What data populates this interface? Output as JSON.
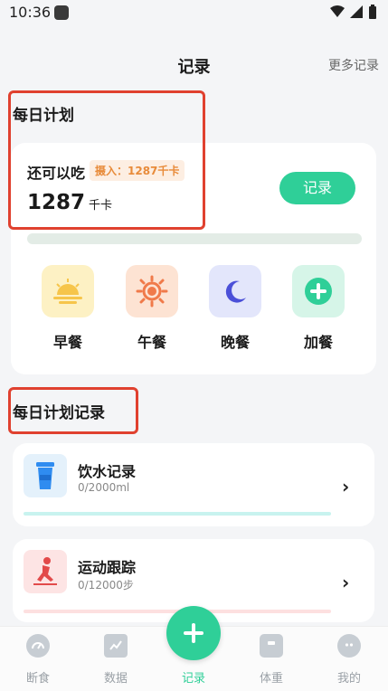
{
  "status_bar": {
    "time": "10:36"
  },
  "header": {
    "title": "记录",
    "more": "更多记录"
  },
  "daily_plan": {
    "section_title": "每日计划",
    "remain_label": "还可以吃",
    "intake_badge": "摄入：1287千卡",
    "kcal_value": "1287",
    "kcal_unit": "千卡",
    "record_button": "记录",
    "progress_fraction": 0.0
  },
  "meals": [
    {
      "label": "早餐",
      "icon": "sunrise-icon",
      "bg": "#fdf1c4"
    },
    {
      "label": "午餐",
      "icon": "sun-icon",
      "bg": "#fde3d3"
    },
    {
      "label": "晚餐",
      "icon": "moon-icon",
      "bg": "#e3e6fb"
    },
    {
      "label": "加餐",
      "icon": "plus-circle-icon",
      "bg": "#d6f5e8"
    }
  ],
  "plan_records": {
    "section_title": "每日计划记录",
    "items": [
      {
        "title": "饮水记录",
        "sub": "0/2000ml",
        "icon": "water-cup-icon",
        "bar_color": "#c8f3ef"
      },
      {
        "title": "运动跟踪",
        "sub": "0/12000步",
        "icon": "runner-icon",
        "bar_color": "#fde0e0"
      }
    ]
  },
  "bottom_nav": [
    {
      "label": "断食",
      "icon": "gauge-icon"
    },
    {
      "label": "数据",
      "icon": "chart-icon"
    },
    {
      "label": "记录",
      "icon": "plus-icon"
    },
    {
      "label": "体重",
      "icon": "scale-icon"
    },
    {
      "label": "我的",
      "icon": "profile-icon"
    }
  ],
  "colors": {
    "accent": "#2fcf98",
    "highlight": "#e0412f"
  }
}
